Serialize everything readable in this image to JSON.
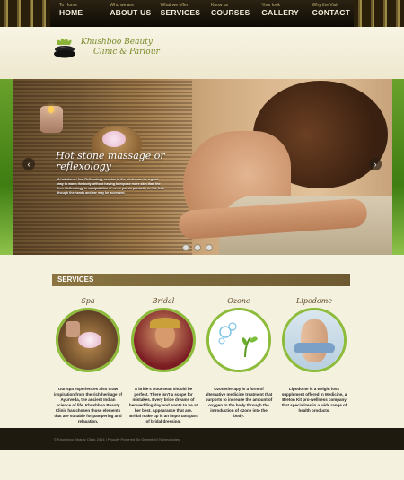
{
  "nav": {
    "items": [
      {
        "small": "To Home",
        "big": "HOME"
      },
      {
        "small": "Who we are",
        "big": "ABOUT US"
      },
      {
        "small": "What we offer",
        "big": "SERVICES"
      },
      {
        "small": "Know us",
        "big": "COURSES"
      },
      {
        "small": "Your look",
        "big": "GALLERY"
      },
      {
        "small": "Why the Visit",
        "big": "CONTACT"
      }
    ]
  },
  "logo": {
    "line1": "Khushboo Beauty",
    "line2": "Clinic & Parlour"
  },
  "slider": {
    "title_line1": "Hot stone massage or",
    "title_line2": "reflexology",
    "text": "A hot stone / foot Reflexology session in the winter can be a good way to warm the body without having to expose more skin than the feet. Reflexology is manipulation of nerve points primarily on the feet, though the hands and ear may be accessed.",
    "prev_arrow": "‹",
    "next_arrow": "›"
  },
  "services": {
    "heading": "SERVICES",
    "items": [
      {
        "title": "Spa",
        "desc": "Our spa experiences also draw inspiration from the rich heritage of Ayurveda, the ancient Indian science of life. Khushboo Beauty Clinic has chosen those elements that are suitable for pampering and relaxation."
      },
      {
        "title": "Bridal",
        "desc": "A bride's trousseau should be perfect. There isn't a scope for mistakes. Every bride dreams of her wedding day and wants to be at her best. Appearance that are. Bridal make up is an important part of bridal dressing."
      },
      {
        "title": "Ozone",
        "desc": "Ozonetherapy is a form of alternative medicine treatment that purports to increase the amount of oxygen to the body through the introduction of ozone into the body."
      },
      {
        "title": "Lipodome",
        "desc": "Lipodome is a weight loss supplement offered in Medicine, a Breton Kit pro-wellness company that specializes in a wide range of health products."
      }
    ]
  },
  "footer": {
    "text": "© Khushboo Beauty Clinic 2014 | Proudly Powered By Greenfield Technologies"
  }
}
